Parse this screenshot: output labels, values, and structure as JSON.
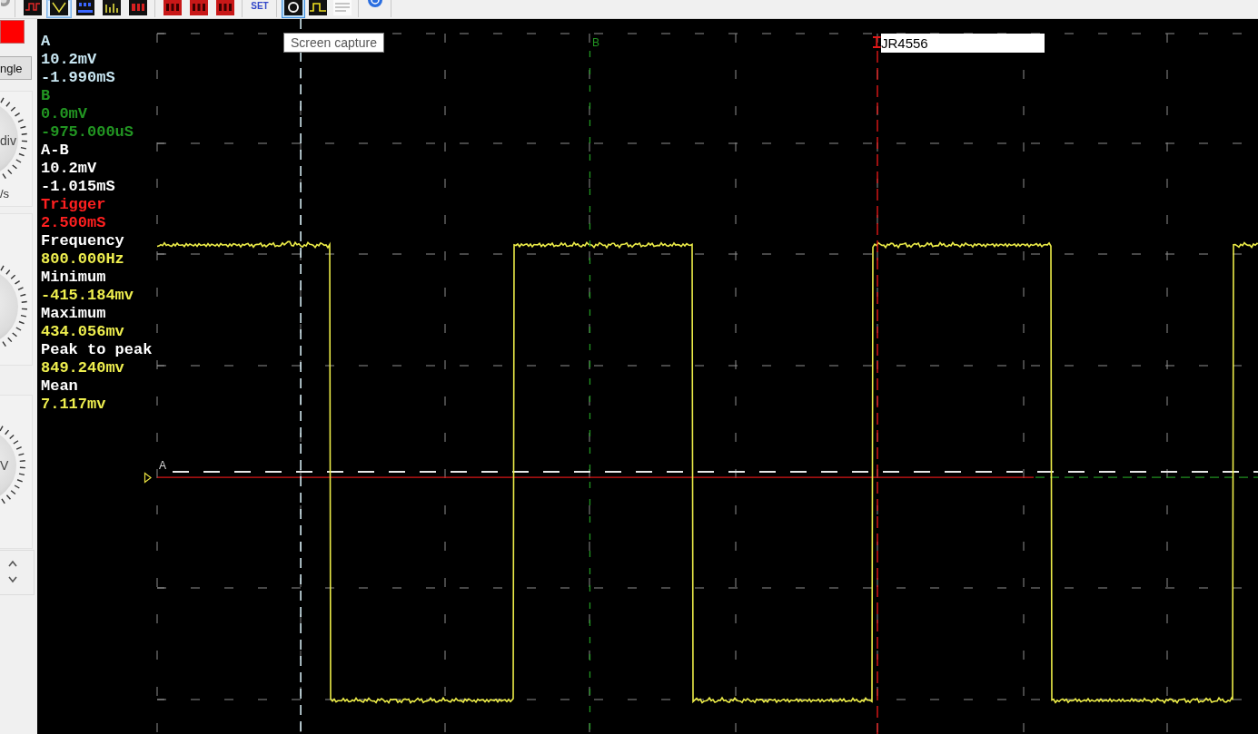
{
  "toolbar": {
    "groups": [
      [
        {
          "kind": "icon",
          "selected": false,
          "hovered": false
        }
      ],
      [
        {
          "kind": "icon",
          "selected": false,
          "hovered": false
        },
        {
          "kind": "icon",
          "selected": true,
          "hovered": false
        },
        {
          "kind": "icon",
          "selected": false,
          "hovered": false
        },
        {
          "kind": "icon",
          "selected": false,
          "hovered": false
        },
        {
          "kind": "icon",
          "selected": false,
          "hovered": false
        }
      ],
      [
        {
          "kind": "icon",
          "selected": false,
          "hovered": false
        },
        {
          "kind": "icon",
          "selected": false,
          "hovered": false
        },
        {
          "kind": "icon",
          "selected": false,
          "hovered": false
        }
      ],
      [
        {
          "kind": "text",
          "label": "SET",
          "selected": false,
          "hovered": false
        }
      ],
      [
        {
          "kind": "icon",
          "selected": false,
          "hovered": true
        },
        {
          "kind": "icon",
          "selected": false,
          "hovered": false
        },
        {
          "kind": "icon",
          "selected": false,
          "hovered": false
        }
      ],
      [
        {
          "kind": "icon",
          "selected": false,
          "hovered": false
        }
      ]
    ]
  },
  "tooltip": {
    "text": "Screen capture"
  },
  "left_panel": {
    "single_button": {
      "label": "ngle"
    },
    "knobs": [
      {
        "kind": "labeled",
        "label": "div",
        "caption": "/s"
      },
      {
        "kind": "plain"
      },
      {
        "kind": "labeled",
        "label": "V"
      }
    ]
  },
  "scope": {
    "readouts": [
      {
        "label": "A",
        "color": "#c8e6f2",
        "values": [
          "10.2mV",
          "-1.990mS"
        ]
      },
      {
        "label": "B",
        "color": "#229522",
        "values": [
          "0.0mV",
          "-975.000uS"
        ]
      },
      {
        "label": "A-B",
        "color": "#ffffff",
        "values": [
          "10.2mV",
          "-1.015mS"
        ]
      },
      {
        "label": "Trigger",
        "color": "#ff2020",
        "values": [
          "2.500mS"
        ]
      }
    ],
    "measurements": [
      {
        "label": "Frequency",
        "value": "800.000Hz"
      },
      {
        "label": "Minimum",
        "value": "-415.184mv"
      },
      {
        "label": "Maximum",
        "value": "434.056mv"
      },
      {
        "label": "Peak to peak",
        "value": "849.240mv"
      },
      {
        "label": "Mean",
        "value": "7.117mv"
      }
    ],
    "cursor_b": {
      "label": "B"
    },
    "channel_a": {
      "label": "A"
    },
    "label_box": {
      "text": "JR4556"
    }
  }
}
